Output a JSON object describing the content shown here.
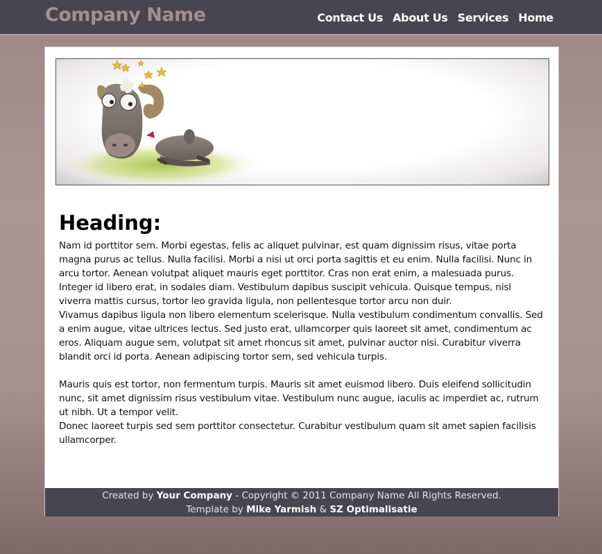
{
  "header": {
    "brand": "Company Name",
    "nav": [
      "Contact Us",
      "About Us",
      "Services",
      "Home"
    ]
  },
  "banner": {
    "image": "cartoon-ram-with-stars-icon"
  },
  "content": {
    "heading": "Heading:",
    "paragraphs": [
      "Nam id porttitor sem. Morbi egestas, felis ac aliquet pulvinar, est quam dignissim risus, vitae porta magna purus ac tellus. Nulla facilisi. Morbi a nisi ut orci porta sagittis et eu enim. Nulla facilisi. Nunc in arcu tortor. Aenean volutpat aliquet mauris eget porttitor. Cras non erat enim, a malesuada purus. Integer id libero erat, in sodales diam. Vestibulum dapibus suscipit vehicula. Quisque tempus, nisl viverra mattis cursus, tortor leo gravida ligula, non pellentesque tortor arcu non duir.",
      "Vivamus dapibus ligula non libero elementum scelerisque. Nulla vestibulum condimentum convallis. Sed a enim augue, vitae ultrices lectus. Sed justo erat, ullamcorper quis laoreet sit amet, condimentum ac eros. Aliquam augue sem, volutpat sit amet rhoncus sit amet, pulvinar auctor nisi. Curabitur viverra blandit orci id porta. Aenean adipiscing tortor sem, sed vehicula turpis.",
      "Mauris quis est tortor, non fermentum turpis. Mauris sit amet euismod libero. Duis eleifend sollicitudin nunc, sit amet dignissim risus vestibulum vitae. Vestibulum nunc augue, iaculis ac imperdiet ac, rutrum ut nibh. Ut a tempor velit.",
      "Donec laoreet turpis sed sem porttitor consectetur. Curabitur vestibulum quam sit amet sapien facilisis ullamcorper."
    ]
  },
  "footer": {
    "created_by": "Created by ",
    "company": "Your Company",
    "copyright": " - Copyright © 2011 Company Name All Rights Reserved.",
    "template_by": "Template by ",
    "author": "Mike Yarmish",
    "amp": " & ",
    "partner": "SZ Optimalisatie"
  },
  "colors": {
    "header_bg": "#474551",
    "brand": "#a48f8f",
    "page_bg": "#a89090",
    "footer_bg": "#474551"
  }
}
